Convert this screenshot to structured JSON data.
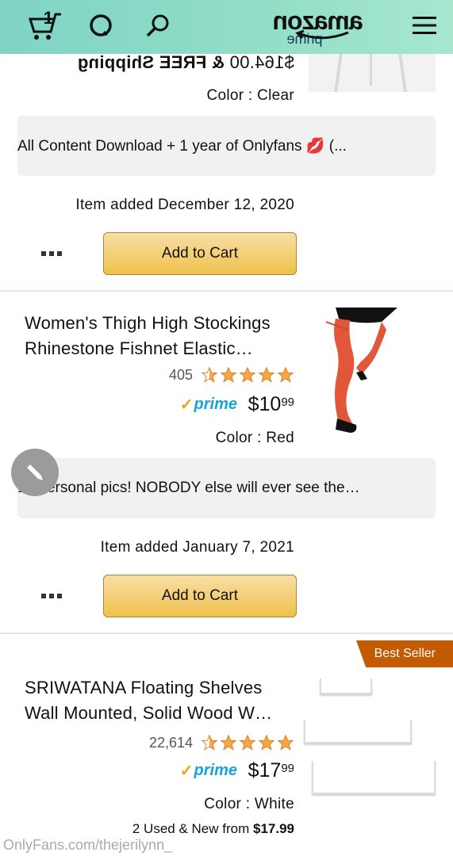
{
  "header": {
    "logo_main": "amazon",
    "logo_sub": "prime",
    "cart_count": "1"
  },
  "item1": {
    "price": "$164.00",
    "shipping": "& FREE Shipping",
    "color": "Color : Clear",
    "note": "All Content Download + 1 year of Onlyfans 💋 (...",
    "added": "Item added December 12, 2020",
    "cart_button": "Add to Cart"
  },
  "item2": {
    "title": "Women's Thigh High Stockings Rhinestone Fishnet Elastic…",
    "rating": 4,
    "review_count": "405",
    "price_whole": "$10",
    "price_frac": "99",
    "prime": "prime",
    "color": "Color : Red",
    "note": "10 personal pics! NOBODY else will ever see the…",
    "added": "Item added January 7, 2021",
    "cart_button": "Add to Cart"
  },
  "item3": {
    "badge": "Best Seller",
    "title": "SRIWATANA Floating Shelves Wall Mounted, Solid Wood W…",
    "rating": 4,
    "review_count": "22,614",
    "price_whole": "$17",
    "price_frac": "99",
    "prime": "prime",
    "color": "Color : White",
    "offers_prefix": "2 Used & New",
    "offers_from": "from",
    "offers_price": "$17.99"
  },
  "watermark": "OnlyFans.com/thejerilynn_",
  "colors": {
    "header_gradient_start": "#a6e7ce",
    "header_gradient_end": "#7fd4c4",
    "button_yellow": "#f0c14b",
    "best_seller": "#c35a04",
    "prime_blue": "#1aa3d8",
    "star": "#f3a847"
  }
}
